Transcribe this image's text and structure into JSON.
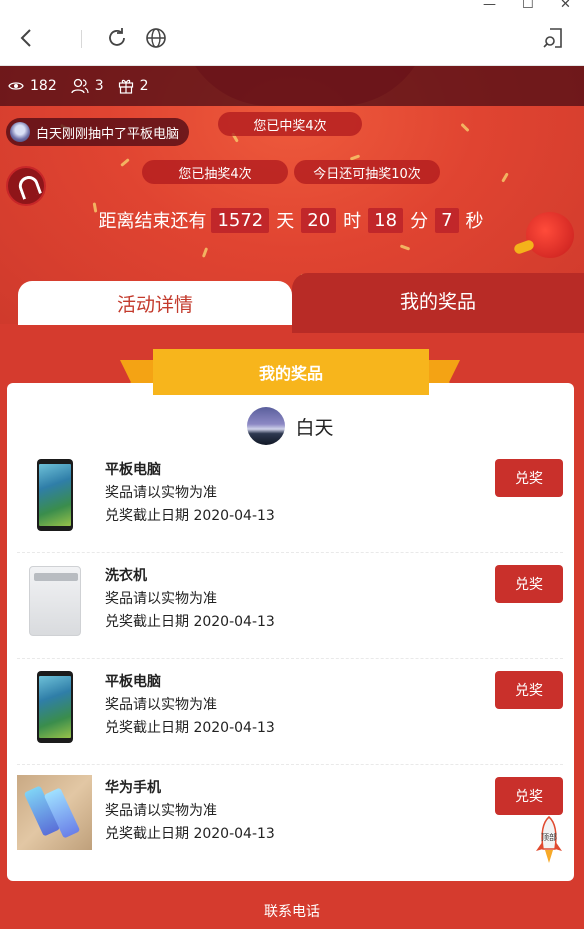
{
  "browser": {
    "back_icon": "chevron-left-icon",
    "reload_icon": "reload-icon",
    "globe_icon": "globe-icon",
    "menu_icon": "page-menu-icon"
  },
  "stats": {
    "views": "182",
    "participants": "3",
    "gifts": "2"
  },
  "winner_ticker": "白天刚刚抽中了平板电脑",
  "draws": {
    "won": "您已中奖4次",
    "drawn": "您已抽奖4次",
    "remaining": "今日还可抽奖10次"
  },
  "countdown": {
    "prefix": "距离结束还有",
    "days": "1572",
    "days_unit": "天",
    "hours": "20",
    "hours_unit": "时",
    "minutes": "18",
    "minutes_unit": "分",
    "seconds": "7",
    "seconds_unit": "秒"
  },
  "tabs": {
    "details": "活动详情",
    "my_prizes": "我的奖品"
  },
  "panel": {
    "ribbon_title": "我的奖品",
    "user_name": "白天"
  },
  "prizes": [
    {
      "name": "平板电脑",
      "note": "奖品请以实物为准",
      "deadline": "兑奖截止日期 2020-04-13",
      "button": "兑奖",
      "image": "tablet"
    },
    {
      "name": "洗衣机",
      "note": "奖品请以实物为准",
      "deadline": "兑奖截止日期 2020-04-13",
      "button": "兑奖",
      "image": "washing-machine"
    },
    {
      "name": "平板电脑",
      "note": "奖品请以实物为准",
      "deadline": "兑奖截止日期 2020-04-13",
      "button": "兑奖",
      "image": "tablet"
    },
    {
      "name": "华为手机",
      "note": "奖品请以实物为准",
      "deadline": "兑奖截止日期 2020-04-13",
      "button": "兑奖",
      "image": "phones"
    }
  ],
  "rocket_label": "顶部",
  "footer": "联系电话",
  "colors": {
    "primary_red": "#d53b2e",
    "dark_red": "#b82b26",
    "button_red": "#c9302b",
    "ribbon_gold": "#f7b51c"
  }
}
